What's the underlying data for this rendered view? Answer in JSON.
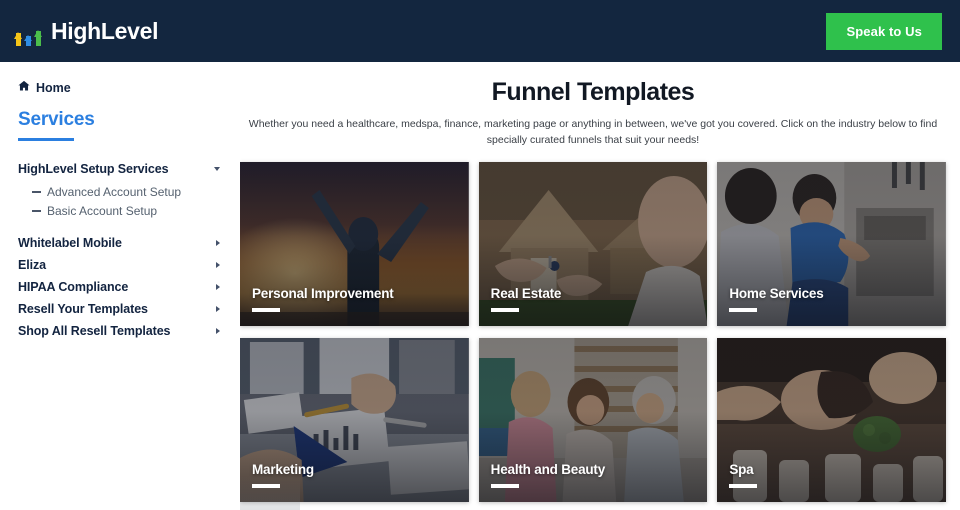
{
  "header": {
    "brand_name": "HighLevel",
    "logo_icon": "three-up-arrows-icon",
    "cta_label": "Speak to Us",
    "bg_color": "#13263f",
    "cta_color": "#2fc14c"
  },
  "sidebar": {
    "home_label": "Home",
    "home_icon": "house-icon",
    "section_title": "Services",
    "accent_color": "#2b7fe0",
    "items": [
      {
        "label": "HighLevel Setup Services",
        "chevron": "chevron-down-icon",
        "expanded": true,
        "children": [
          {
            "label": "Advanced Account Setup"
          },
          {
            "label": "Basic Account Setup"
          }
        ]
      },
      {
        "label": "Whitelabel Mobile",
        "chevron": "chevron-right-icon",
        "expanded": false
      },
      {
        "label": "Eliza",
        "chevron": "chevron-right-icon",
        "expanded": false
      },
      {
        "label": "HIPAA Compliance",
        "chevron": "chevron-right-icon",
        "expanded": false
      },
      {
        "label": "Resell Your Templates",
        "chevron": "chevron-right-icon",
        "expanded": false
      },
      {
        "label": "Shop All Resell Templates",
        "chevron": "chevron-right-icon",
        "expanded": false
      }
    ]
  },
  "main": {
    "title": "Funnel Templates",
    "subtitle": "Whether you need a healthcare, medspa, finance, marketing page or anything in between, we've got you covered. Click on the industry below to find specially curated funnels that suit your needs!",
    "cards": [
      {
        "title": "Personal Improvement",
        "image": "person-with-raised-arms-at-sunset-photo"
      },
      {
        "title": "Real Estate",
        "image": "handing-over-house-keys-photo"
      },
      {
        "title": "Home Services",
        "image": "technician-repairing-appliance-photo"
      },
      {
        "title": "Marketing",
        "image": "team-reviewing-charts-on-desk-photo"
      },
      {
        "title": "Health and Beauty",
        "image": "three-women-laughing-in-gym-photo"
      },
      {
        "title": "Spa",
        "image": "woman-receiving-massage-with-candles-photo"
      }
    ]
  }
}
